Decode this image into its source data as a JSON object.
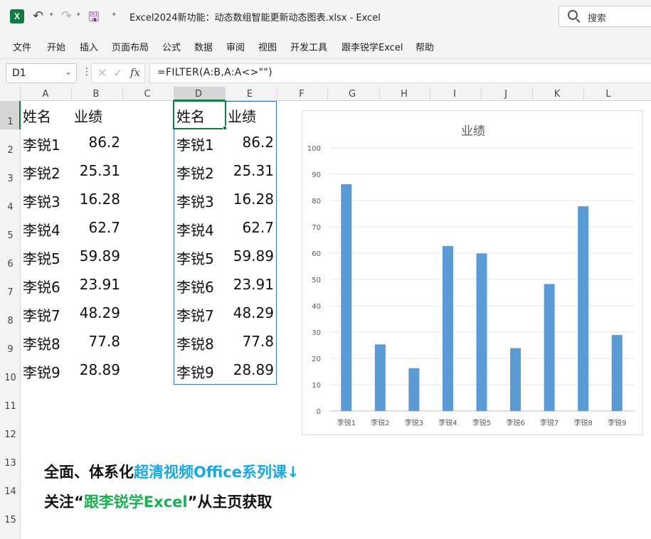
{
  "window": {
    "title": "Excel2024新功能：动态数组智能更新动态图表.xlsx  -  Excel",
    "logo_text": "X",
    "search_placeholder": "搜索"
  },
  "menu": [
    "文件",
    "开始",
    "插入",
    "页面布局",
    "公式",
    "数据",
    "审阅",
    "视图",
    "开发工具",
    "跟李锐学Excel",
    "帮助"
  ],
  "formula_bar": {
    "name_box": "D1",
    "formula": "=FILTER(A:B,A:A<>\"\")",
    "fx": "fx"
  },
  "columns": [
    "A",
    "B",
    "C",
    "D",
    "E",
    "F",
    "G",
    "H",
    "I",
    "J",
    "K",
    "L"
  ],
  "rows": [
    "1",
    "2",
    "3",
    "4",
    "5",
    "6",
    "7",
    "8",
    "9",
    "10",
    "11",
    "12",
    "13",
    "14",
    "15"
  ],
  "source_table": {
    "headers": [
      "姓名",
      "业绩"
    ],
    "rows": [
      [
        "李锐1",
        "86.2"
      ],
      [
        "李锐2",
        "25.31"
      ],
      [
        "李锐3",
        "16.28"
      ],
      [
        "李锐4",
        "62.7"
      ],
      [
        "李锐5",
        "59.89"
      ],
      [
        "李锐6",
        "23.91"
      ],
      [
        "李锐7",
        "48.29"
      ],
      [
        "李锐8",
        "77.8"
      ],
      [
        "李锐9",
        "28.89"
      ]
    ]
  },
  "spill_table": {
    "headers": [
      "姓名",
      "业绩"
    ],
    "rows": [
      [
        "李锐1",
        "86.2"
      ],
      [
        "李锐2",
        "25.31"
      ],
      [
        "李锐3",
        "16.28"
      ],
      [
        "李锐4",
        "62.7"
      ],
      [
        "李锐5",
        "59.89"
      ],
      [
        "李锐6",
        "23.91"
      ],
      [
        "李锐7",
        "48.29"
      ],
      [
        "李锐8",
        "77.8"
      ],
      [
        "李锐9",
        "28.89"
      ]
    ]
  },
  "chart_data": {
    "type": "bar",
    "title": "业绩",
    "categories": [
      "李锐1",
      "李锐2",
      "李锐3",
      "李锐4",
      "李锐5",
      "李锐6",
      "李锐7",
      "李锐8",
      "李锐9"
    ],
    "values": [
      86.2,
      25.31,
      16.28,
      62.7,
      59.89,
      23.91,
      48.29,
      77.8,
      28.89
    ],
    "ylim": [
      0,
      100
    ],
    "yticks": [
      0,
      10,
      20,
      30,
      40,
      50,
      60,
      70,
      80,
      90,
      100
    ],
    "grid": true,
    "bar_color": "#5b9bd5",
    "xlabel": "",
    "ylabel": ""
  },
  "promo": {
    "line1_a": "全面、体系化",
    "line1_b": "超清视频Office系列课↓",
    "line2_a": "关注“",
    "line2_b": "跟李锐学Excel",
    "line2_c": "”从主页获取"
  },
  "colors": {
    "excel_green": "#107c41",
    "spill_border": "#3b6fb6",
    "promo_blue": "#19a7e0",
    "promo_green": "#1fae55"
  }
}
